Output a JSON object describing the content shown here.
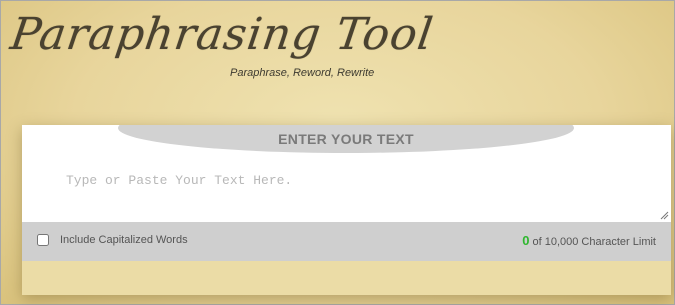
{
  "header": {
    "title": "Paraphrasing Tool",
    "subtitle": "Paraphrase, Reword, Rewrite"
  },
  "editor": {
    "heading": "ENTER YOUR TEXT",
    "placeholder": "Type or Paste Your Text Here.",
    "value": ""
  },
  "options": {
    "capitalized_label": "Include Capitalized Words",
    "capitalized_checked": false
  },
  "counter": {
    "count": "0",
    "limit_text": "of 10,000 Character Limit"
  },
  "colors": {
    "background": "#e6d296",
    "count_green": "#2fb72f",
    "bar_gray": "#cfcfcf"
  }
}
